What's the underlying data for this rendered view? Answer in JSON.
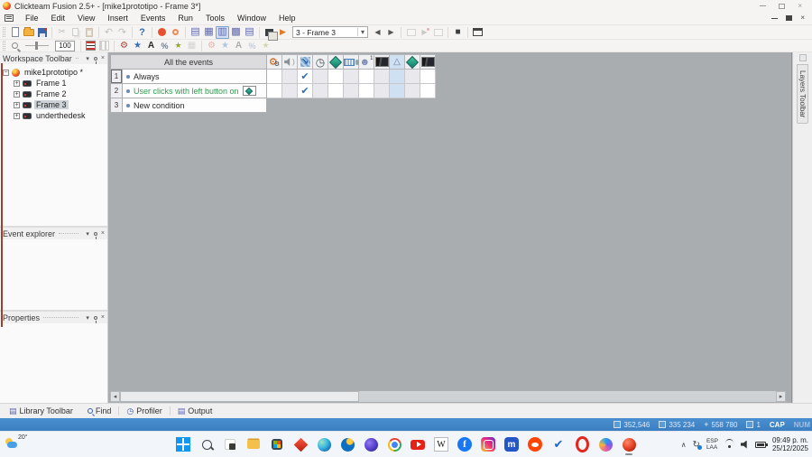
{
  "window": {
    "title": "Clickteam Fusion 2.5+  - [mike1prototipo - Frame 3*]"
  },
  "menus": [
    "File",
    "Edit",
    "View",
    "Insert",
    "Events",
    "Run",
    "Tools",
    "Window",
    "Help"
  ],
  "toolbar": {
    "frame_selector": "3 - Frame 3",
    "zoom_value": "100"
  },
  "workspace_panel": {
    "title": "Workspace Toolbar",
    "root": "mike1prototipo *",
    "items": [
      "Frame 1",
      "Frame 2",
      "Frame 3",
      "underthedesk"
    ],
    "selected": "Frame 3"
  },
  "event_explorer_panel": {
    "title": "Event explorer"
  },
  "properties_panel": {
    "title": "Properties"
  },
  "layers_panel": {
    "title": "Layers Toolbar"
  },
  "event_editor": {
    "header": "All the events",
    "columns": [
      "special-conditions",
      "sound",
      "storyboard-controls",
      "timer",
      "create-new-objects",
      "mouse-keyboard",
      "player-1",
      "backdrop-a",
      "quick-backdrop",
      "active-object",
      "backdrop-b"
    ],
    "highlighted_column_index": 8,
    "rows": [
      {
        "num": "1",
        "text": "Always",
        "checked_column_index": 2
      },
      {
        "num": "2",
        "text": "User clicks with left button on",
        "checked_column_index": 2,
        "has_object_icon": true
      },
      {
        "num": "3",
        "text": "New condition"
      }
    ]
  },
  "bottom_tabs": {
    "library": "Library Toolbar",
    "find": "Find",
    "profiler": "Profiler",
    "output": "Output"
  },
  "status_bar": {
    "size_a": "352,546",
    "size_b": "335 234",
    "position": "558 780",
    "layer": "1",
    "cap": "CAP",
    "num": "NUM"
  },
  "taskbar": {
    "weather_temp": "20°",
    "apps": [
      "start",
      "search",
      "task-view",
      "explorer",
      "store",
      "fusion-diamond",
      "edge",
      "bing",
      "firefox",
      "chrome",
      "youtube",
      "wikipedia",
      "facebook",
      "instagram",
      "mega",
      "reddit",
      "check",
      "opera",
      "copilot",
      "fusion-active"
    ],
    "app_letters": {
      "wikipedia": "W",
      "facebook": "f",
      "mega": "m",
      "check": "✔"
    },
    "lang_line1": "ESP",
    "lang_line2": "LAA",
    "time": "09:49 p. m.",
    "date": "25/12/2025"
  },
  "glyphs": {
    "check": "✔",
    "scissors": "✂",
    "undo": "↶",
    "redo": "↷",
    "help": "?",
    "dd_arrow": "▾",
    "prev": "◀",
    "next": "▶",
    "stop": "■",
    "play": "▶",
    "sb_editor": "▤",
    "frame_editor": "▦",
    "event_editor": "▥",
    "event_list": "▩",
    "data_list": "▤",
    "gear": "⚙",
    "star": "★",
    "letter_a": "A",
    "percent": "%",
    "spark": "★",
    "grid": "▦",
    "clock": "◷",
    "tab_grid": "▤",
    "minus": "−",
    "plus": "+",
    "close": "×",
    "left": "◂",
    "right": "▸",
    "caret": "∧",
    "refresh": "↻",
    "panel_dd": "▾"
  }
}
